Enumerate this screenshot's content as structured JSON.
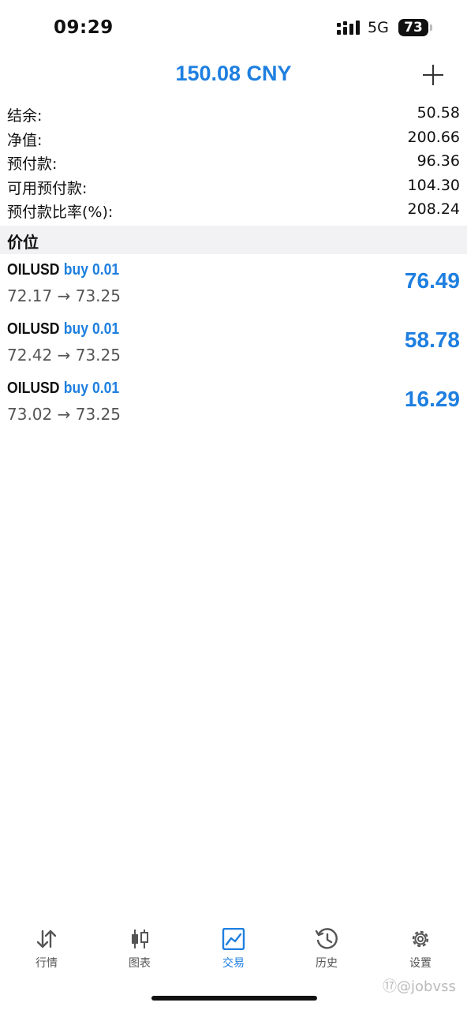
{
  "status": {
    "time": "09:29",
    "network": "5G",
    "battery": "73"
  },
  "header": {
    "title": "150.08 CNY"
  },
  "account": [
    {
      "label": "结余:",
      "value": "50.58"
    },
    {
      "label": "净值:",
      "value": "200.66"
    },
    {
      "label": "预付款:",
      "value": "96.36"
    },
    {
      "label": "可用预付款:",
      "value": "104.30"
    },
    {
      "label": "预付款比率(%):",
      "value": "208.24"
    }
  ],
  "section": {
    "title": "价位"
  },
  "positions": [
    {
      "symbol": "OILUSD",
      "side": "buy 0.01",
      "prices": "72.17 → 73.25",
      "profit": "76.49"
    },
    {
      "symbol": "OILUSD",
      "side": "buy 0.01",
      "prices": "72.42 → 73.25",
      "profit": "58.78"
    },
    {
      "symbol": "OILUSD",
      "side": "buy 0.01",
      "prices": "73.02 → 73.25",
      "profit": "16.29"
    }
  ],
  "tabs": [
    {
      "label": "行情",
      "icon": "quotes-arrows-icon"
    },
    {
      "label": "图表",
      "icon": "candlestick-icon"
    },
    {
      "label": "交易",
      "icon": "trade-chart-icon",
      "active": true
    },
    {
      "label": "历史",
      "icon": "history-clock-icon"
    },
    {
      "label": "设置",
      "icon": "gear-icon"
    }
  ],
  "watermark": "⑰@jobvss",
  "colors": {
    "accent": "#1e7fe0",
    "text": "#111111",
    "section_bg": "#f2f2f4"
  }
}
